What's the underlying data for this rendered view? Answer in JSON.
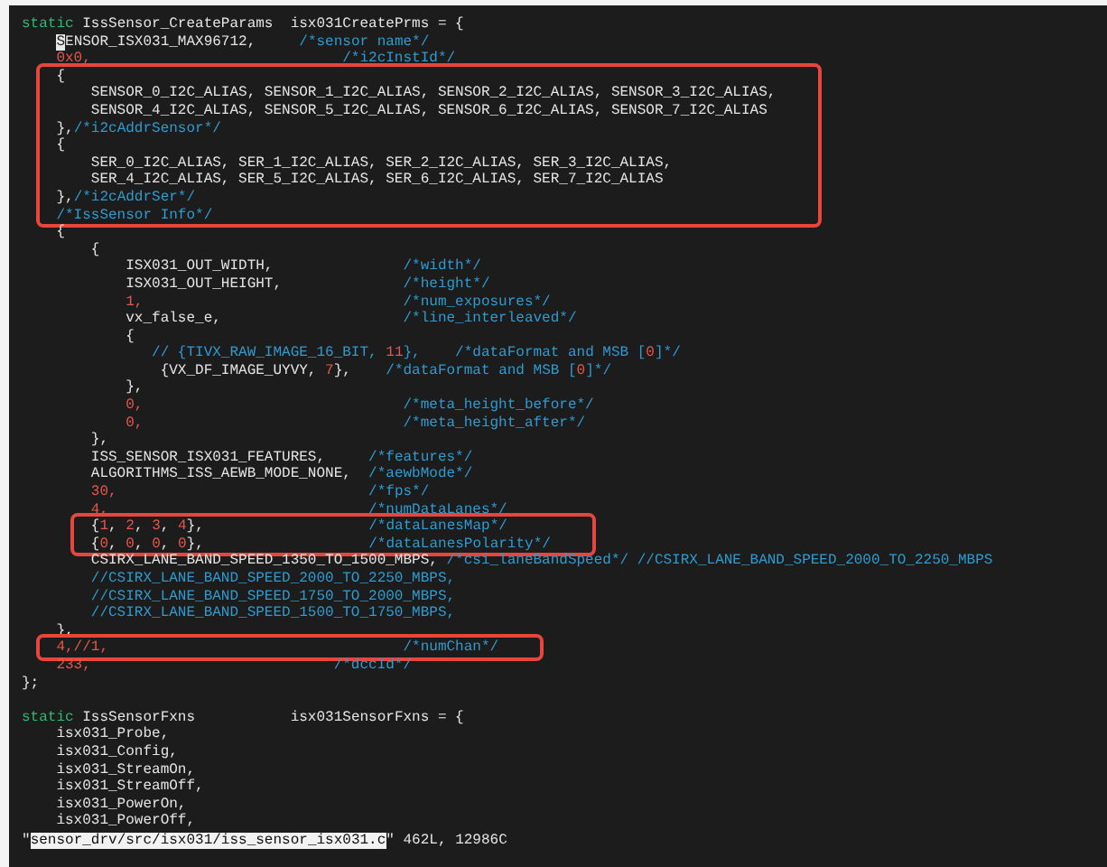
{
  "editor": {
    "blocks": [
      {
        "boxed": false,
        "gap_before": false,
        "lines": [
          {
            "tokens": [
              {
                "kind": "keyword",
                "text": "static"
              },
              {
                "kind": "plain",
                "text": " IssSensor_CreateParams  isx031CreatePrms = {"
              }
            ]
          },
          {
            "tokens": [
              {
                "kind": "cursor",
                "text": "    S"
              },
              {
                "kind": "plain",
                "text": "ENSOR_ISX031_MAX96712,"
              },
              {
                "kind": "comment",
                "text": "     /*sensor name*/"
              }
            ]
          },
          {
            "tokens": [
              {
                "kind": "number",
                "text": "    0x0,"
              },
              {
                "kind": "comment",
                "text": "                             /*i2cInstId*/"
              }
            ]
          }
        ]
      },
      {
        "boxed": true,
        "gap_before": false,
        "lines": [
          {
            "tokens": [
              {
                "kind": "plain",
                "text": "    {"
              }
            ]
          },
          {
            "tokens": [
              {
                "kind": "plain",
                "text": "        SENSOR_0_I2C_ALIAS, SENSOR_1_I2C_ALIAS, SENSOR_2_I2C_ALIAS, SENSOR_3_I2C_ALIAS,"
              }
            ]
          },
          {
            "tokens": [
              {
                "kind": "plain",
                "text": "        SENSOR_4_I2C_ALIAS, SENSOR_5_I2C_ALIAS, SENSOR_6_I2C_ALIAS, SENSOR_7_I2C_ALIAS"
              }
            ]
          },
          {
            "tokens": [
              {
                "kind": "plain",
                "text": "    },"
              },
              {
                "kind": "comment",
                "text": "/*i2cAddrSensor*/"
              }
            ]
          },
          {
            "tokens": [
              {
                "kind": "plain",
                "text": "    {"
              }
            ]
          },
          {
            "tokens": [
              {
                "kind": "plain",
                "text": "        SER_0_I2C_ALIAS, SER_1_I2C_ALIAS, SER_2_I2C_ALIAS, SER_3_I2C_ALIAS,"
              }
            ]
          },
          {
            "tokens": [
              {
                "kind": "plain",
                "text": "        SER_4_I2C_ALIAS, SER_5_I2C_ALIAS, SER_6_I2C_ALIAS, SER_7_I2C_ALIAS"
              }
            ]
          },
          {
            "tokens": [
              {
                "kind": "plain",
                "text": "    },"
              },
              {
                "kind": "comment",
                "text": "/*i2cAddrSer*/"
              }
            ]
          },
          {
            "tokens": [
              {
                "kind": "comment",
                "text": "    /*IssSensor Info*/"
              }
            ]
          }
        ]
      },
      {
        "boxed": false,
        "gap_before": false,
        "lines": [
          {
            "tokens": [
              {
                "kind": "plain",
                "text": "    {"
              }
            ]
          },
          {
            "tokens": [
              {
                "kind": "plain",
                "text": "        {"
              }
            ]
          },
          {
            "tokens": [
              {
                "kind": "plain",
                "text": "            ISX031_OUT_WIDTH,"
              },
              {
                "kind": "comment",
                "text": "               /*width*/"
              }
            ]
          },
          {
            "tokens": [
              {
                "kind": "plain",
                "text": "            ISX031_OUT_HEIGHT,"
              },
              {
                "kind": "comment",
                "text": "              /*height*/"
              }
            ]
          },
          {
            "tokens": [
              {
                "kind": "number",
                "text": "            1,"
              },
              {
                "kind": "comment",
                "text": "                              /*num_exposures*/"
              }
            ]
          },
          {
            "tokens": [
              {
                "kind": "plain",
                "text": "            vx_false_e,"
              },
              {
                "kind": "comment",
                "text": "                     /*line_interleaved*/"
              }
            ]
          },
          {
            "tokens": [
              {
                "kind": "plain",
                "text": "            {"
              }
            ]
          },
          {
            "tokens": [
              {
                "kind": "comment",
                "text": "               // {TIVX_RAW_IMAGE_16_BIT, "
              },
              {
                "kind": "number",
                "text": "11"
              },
              {
                "kind": "comment",
                "text": "},    /*dataFormat and MSB ["
              },
              {
                "kind": "number",
                "text": "0"
              },
              {
                "kind": "comment",
                "text": "]*/"
              }
            ]
          },
          {
            "tokens": [
              {
                "kind": "plain",
                "text": "                {VX_DF_IMAGE_UYVY, "
              },
              {
                "kind": "number",
                "text": "7"
              },
              {
                "kind": "plain",
                "text": "},"
              },
              {
                "kind": "comment",
                "text": "    /*dataFormat and MSB ["
              },
              {
                "kind": "number",
                "text": "0"
              },
              {
                "kind": "comment",
                "text": "]*/"
              }
            ]
          },
          {
            "tokens": [
              {
                "kind": "plain",
                "text": "            },"
              }
            ]
          },
          {
            "tokens": [
              {
                "kind": "number",
                "text": "            0,"
              },
              {
                "kind": "comment",
                "text": "                              /*meta_height_before*/"
              }
            ]
          },
          {
            "tokens": [
              {
                "kind": "number",
                "text": "            0,"
              },
              {
                "kind": "comment",
                "text": "                              /*meta_height_after*/"
              }
            ]
          },
          {
            "tokens": [
              {
                "kind": "plain",
                "text": "        },"
              }
            ]
          },
          {
            "tokens": [
              {
                "kind": "plain",
                "text": "        ISS_SENSOR_ISX031_FEATURES,"
              },
              {
                "kind": "comment",
                "text": "     /*features*/"
              }
            ]
          },
          {
            "tokens": [
              {
                "kind": "plain",
                "text": "        ALGORITHMS_ISS_AEWB_MODE_NONE,"
              },
              {
                "kind": "comment",
                "text": "  /*aewbMode*/"
              }
            ]
          },
          {
            "tokens": [
              {
                "kind": "number",
                "text": "        30,"
              },
              {
                "kind": "comment",
                "text": "                             /*fps*/"
              }
            ]
          },
          {
            "tokens": [
              {
                "kind": "number",
                "text": "        4,"
              },
              {
                "kind": "comment",
                "text": "                              /*numDataLanes*/"
              }
            ]
          }
        ]
      },
      {
        "boxed": true,
        "gap_before": false,
        "lines": [
          {
            "tokens": [
              {
                "kind": "plain",
                "text": "        {"
              },
              {
                "kind": "number",
                "text": "1"
              },
              {
                "kind": "plain",
                "text": ", "
              },
              {
                "kind": "number",
                "text": "2"
              },
              {
                "kind": "plain",
                "text": ", "
              },
              {
                "kind": "number",
                "text": "3"
              },
              {
                "kind": "plain",
                "text": ", "
              },
              {
                "kind": "number",
                "text": "4"
              },
              {
                "kind": "plain",
                "text": "},"
              },
              {
                "kind": "comment",
                "text": "                   /*dataLanesMap*/"
              }
            ]
          },
          {
            "tokens": [
              {
                "kind": "plain",
                "text": "        {"
              },
              {
                "kind": "number",
                "text": "0"
              },
              {
                "kind": "plain",
                "text": ", "
              },
              {
                "kind": "number",
                "text": "0"
              },
              {
                "kind": "plain",
                "text": ", "
              },
              {
                "kind": "number",
                "text": "0"
              },
              {
                "kind": "plain",
                "text": ", "
              },
              {
                "kind": "number",
                "text": "0"
              },
              {
                "kind": "plain",
                "text": "},"
              },
              {
                "kind": "comment",
                "text": "                   /*dataLanesPolarity*/"
              }
            ]
          }
        ]
      },
      {
        "boxed": false,
        "gap_before": false,
        "lines": [
          {
            "tokens": [
              {
                "kind": "plain",
                "text": "        CSIRX_LANE_BAND_SPEED_1350_TO_1500_MBPS,"
              },
              {
                "kind": "comment",
                "text": " /*csi_laneBandSpeed*/ //CSIRX_LANE_BAND_SPEED_2000_TO_2250_MBPS"
              }
            ]
          },
          {
            "tokens": [
              {
                "kind": "comment",
                "text": "        //CSIRX_LANE_BAND_SPEED_2000_TO_2250_MBPS,"
              }
            ]
          },
          {
            "tokens": [
              {
                "kind": "comment",
                "text": "        //CSIRX_LANE_BAND_SPEED_1750_TO_2000_MBPS,"
              }
            ]
          },
          {
            "tokens": [
              {
                "kind": "comment",
                "text": "        //CSIRX_LANE_BAND_SPEED_1500_TO_1750_MBPS,"
              }
            ]
          },
          {
            "tokens": [
              {
                "kind": "plain",
                "text": "    },"
              }
            ]
          }
        ]
      },
      {
        "boxed": true,
        "gap_before": false,
        "lines": [
          {
            "tokens": [
              {
                "kind": "number",
                "text": "    4,//1,"
              },
              {
                "kind": "comment",
                "text": "                                  /*numChan*/"
              }
            ]
          }
        ]
      },
      {
        "boxed": false,
        "gap_before": false,
        "lines": [
          {
            "tokens": [
              {
                "kind": "number",
                "text": "    233,"
              },
              {
                "kind": "comment",
                "text": "                            /*dccId*/"
              }
            ]
          },
          {
            "tokens": [
              {
                "kind": "plain",
                "text": "};"
              }
            ]
          }
        ]
      },
      {
        "boxed": false,
        "gap_before": true,
        "lines": [
          {
            "tokens": [
              {
                "kind": "keyword",
                "text": "static"
              },
              {
                "kind": "plain",
                "text": " IssSensorFxns           isx031SensorFxns = {"
              }
            ]
          },
          {
            "tokens": [
              {
                "kind": "plain",
                "text": "    isx031_Probe,"
              }
            ]
          },
          {
            "tokens": [
              {
                "kind": "plain",
                "text": "    isx031_Config,"
              }
            ]
          },
          {
            "tokens": [
              {
                "kind": "plain",
                "text": "    isx031_StreamOn,"
              }
            ]
          },
          {
            "tokens": [
              {
                "kind": "plain",
                "text": "    isx031_StreamOff,"
              }
            ]
          },
          {
            "tokens": [
              {
                "kind": "plain",
                "text": "    isx031_PowerOn,"
              }
            ]
          },
          {
            "tokens": [
              {
                "kind": "plain",
                "text": "    isx031_PowerOff,"
              }
            ]
          }
        ]
      }
    ]
  },
  "status_bar": {
    "tokens": [
      {
        "kind": "plain",
        "text": "\""
      },
      {
        "kind": "selection",
        "text": "sensor_drv/src/isx031/iss_sensor_isx031.c"
      },
      {
        "kind": "plain",
        "text": "\" 462L, 12986C"
      }
    ]
  }
}
